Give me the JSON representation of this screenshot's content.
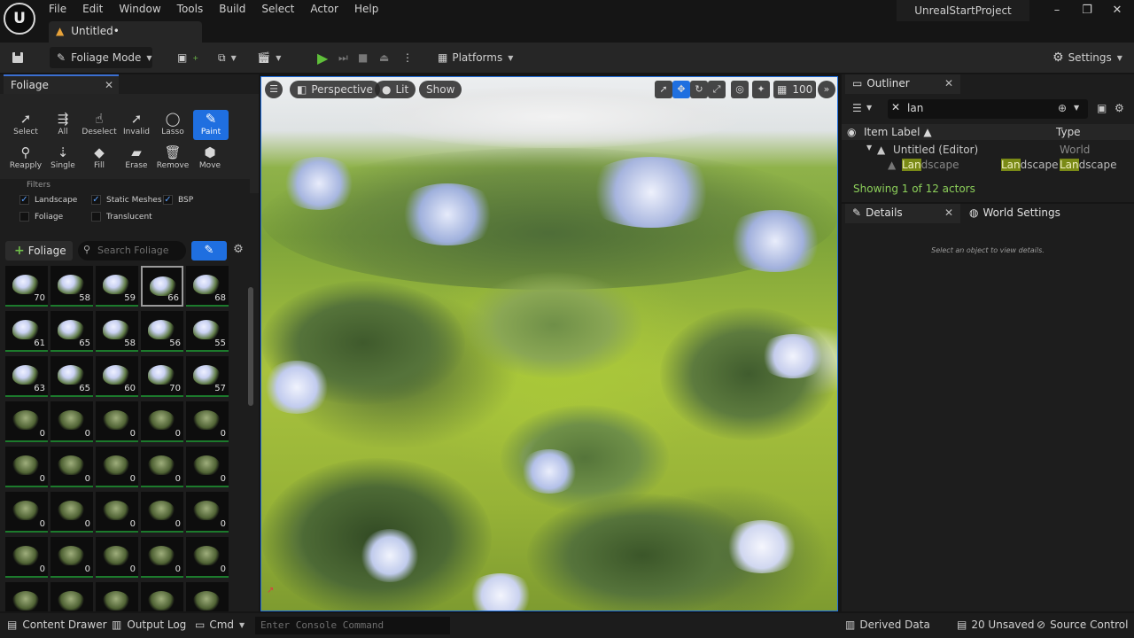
{
  "titlebar": {
    "menu": [
      "File",
      "Edit",
      "Window",
      "Tools",
      "Build",
      "Select",
      "Actor",
      "Help"
    ],
    "doc_tab": "Untitled•",
    "project_name": "UnrealStartProject",
    "window_controls": [
      "minimize-icon",
      "restore-icon",
      "close-icon"
    ]
  },
  "toolbar": {
    "mode": "Foliage Mode",
    "platforms": "Platforms",
    "settings": "Settings",
    "play_color": "#5fbf3a"
  },
  "foliage_panel": {
    "tab": "Foliage",
    "tools_row1": [
      "Select",
      "All",
      "Deselect",
      "Invalid",
      "Lasso",
      "Paint"
    ],
    "tools_row2": [
      "Reapply",
      "Single",
      "Fill",
      "Erase",
      "Remove",
      "Move"
    ],
    "active_tool": "Paint",
    "filters_title": "Filters",
    "filters": [
      {
        "label": "Landscape",
        "checked": true
      },
      {
        "label": "Static Meshes",
        "checked": true
      },
      {
        "label": "BSP",
        "checked": true
      },
      {
        "label": "Foliage",
        "checked": false
      },
      {
        "label": "Translucent",
        "checked": false
      }
    ],
    "add_button": "Foliage",
    "search_placeholder": "Search Foliage",
    "grid_counts": [
      [
        "70",
        "58",
        "59",
        "66",
        "68"
      ],
      [
        "61",
        "65",
        "58",
        "56",
        "55"
      ],
      [
        "63",
        "65",
        "60",
        "70",
        "57"
      ],
      [
        "0",
        "0",
        "0",
        "0",
        "0"
      ],
      [
        "0",
        "0",
        "0",
        "0",
        "0"
      ],
      [
        "0",
        "0",
        "0",
        "0",
        "0"
      ],
      [
        "0",
        "0",
        "0",
        "0",
        "0"
      ],
      [
        "",
        "",
        "",
        "",
        ""
      ]
    ]
  },
  "viewport": {
    "perspective": "Perspective",
    "lit": "Lit",
    "show": "Show",
    "camera_speed": "100"
  },
  "outliner": {
    "tab": "Outliner",
    "search_value": "lan",
    "col_label": "Item Label",
    "col_type": "Type",
    "root_label": "Untitled (Editor)",
    "root_type": "World",
    "child_match": "Lan",
    "child_rest": "dscape",
    "status": "Showing 1 of 12 actors"
  },
  "details": {
    "tab": "Details",
    "world_settings_tab": "World Settings",
    "hint": "Select an object to view details."
  },
  "statusbar": {
    "content_drawer": "Content Drawer",
    "output_log": "Output Log",
    "cmd": "Cmd",
    "console_placeholder": "Enter Console Command",
    "derived_data": "Derived Data",
    "unsaved": "20 Unsaved",
    "source_control": "Source Control"
  }
}
